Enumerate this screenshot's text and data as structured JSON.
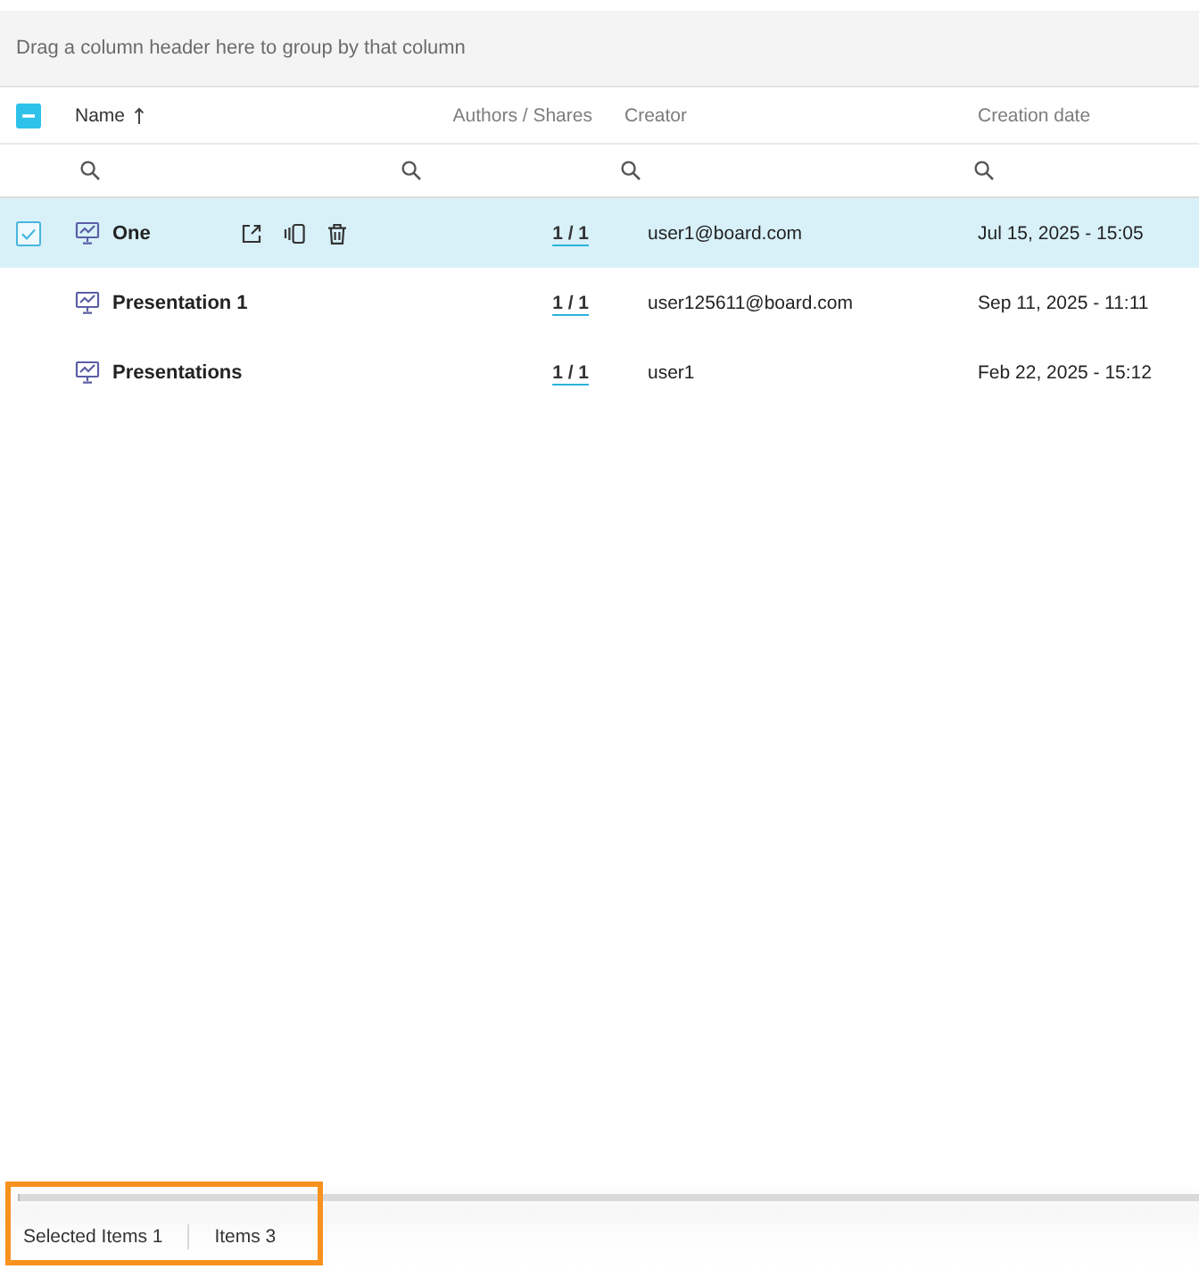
{
  "group_panel": {
    "hint": "Drag a column header here to group by that column"
  },
  "table": {
    "select_all": {
      "checked": false,
      "indeterminate": true
    },
    "columns": [
      {
        "label": "Name",
        "sorted_ascending": true,
        "filter": true
      },
      {
        "label": "Authors / Shares",
        "filter": true
      },
      {
        "label": "Creator",
        "filter": true
      },
      {
        "label": "Creation date",
        "filter": true
      }
    ],
    "rows": [
      {
        "kind": "presentation",
        "name": "One",
        "authors_shares": "1 / 1",
        "creator": "user1@board.com",
        "creation_date": "Jul 15, 2025 - 15:05",
        "selected": true,
        "hovered": true
      },
      {
        "kind": "presentation",
        "name": "Presentation 1",
        "authors_shares": "1 / 1",
        "creator": "user125611@board.com",
        "creation_date": "Sep 11, 2025 - 11:11",
        "selected": false,
        "hovered": false
      },
      {
        "kind": "presentation",
        "name": "Presentations",
        "authors_shares": "1 / 1",
        "creator": "user1",
        "creation_date": "Feb 22, 2025 - 15:12",
        "selected": false,
        "hovered": false
      }
    ]
  },
  "status_bar": {
    "selected_items": "Selected Items 1",
    "items": "Items 3",
    "highlighted": true
  }
}
